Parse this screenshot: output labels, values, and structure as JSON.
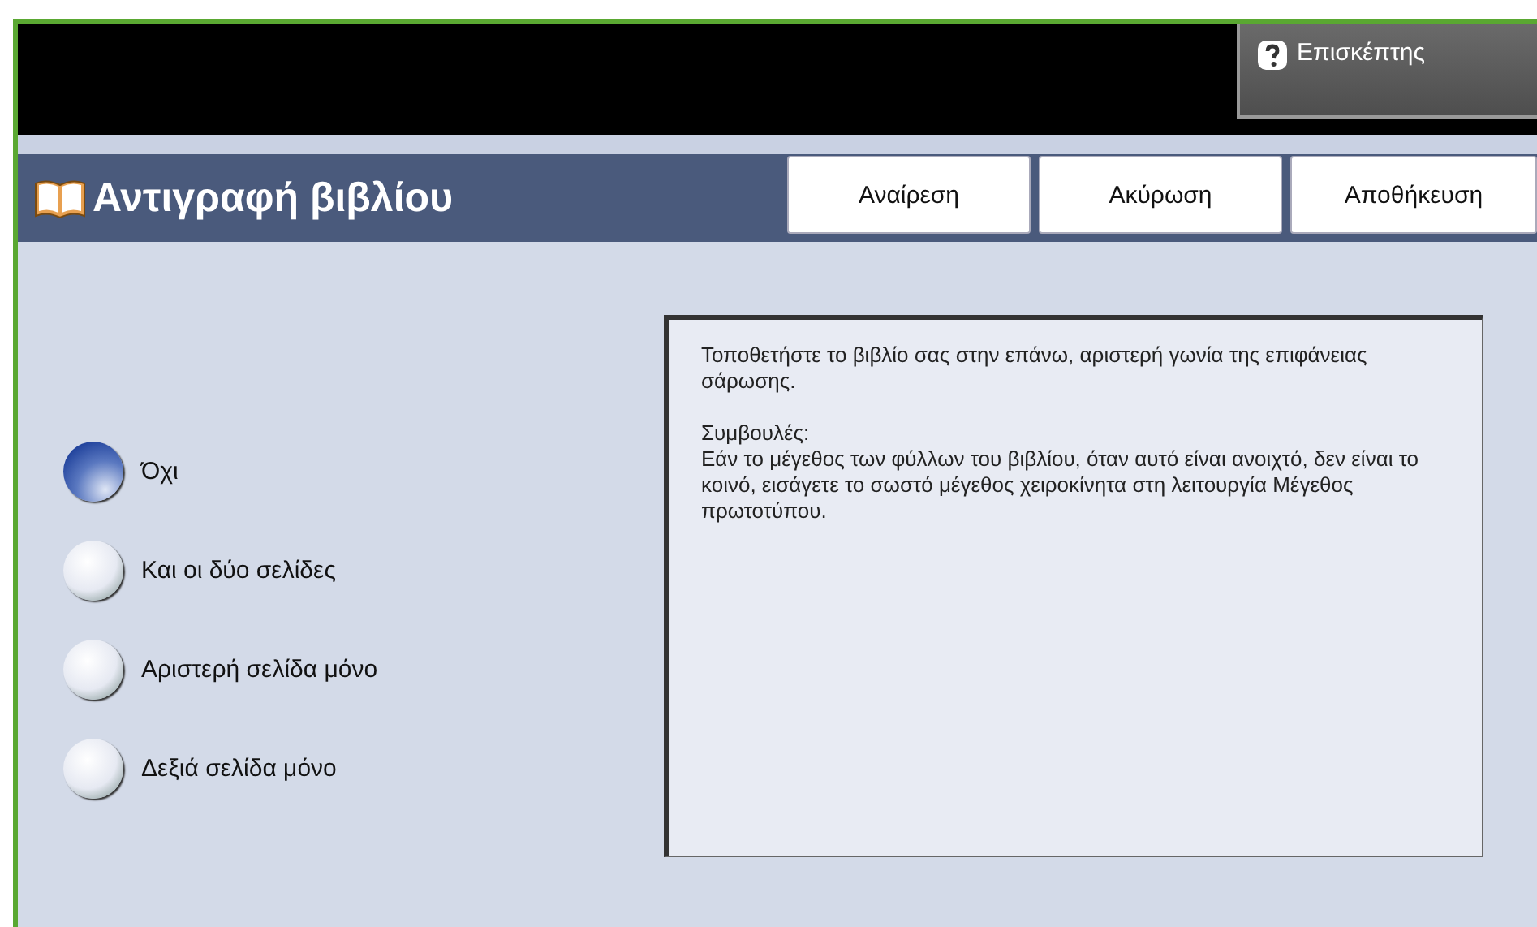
{
  "header": {
    "user_button": "Επισκέπτης"
  },
  "title_bar": {
    "title": "Αντιγραφή βιβλίου",
    "buttons": [
      "Αναίρεση",
      "Ακύρωση",
      "Αποθήκευση"
    ]
  },
  "options": [
    {
      "label": "Όχι",
      "selected": true
    },
    {
      "label": "Και οι δύο σελίδες",
      "selected": false
    },
    {
      "label": "Αριστερή σελίδα μόνο",
      "selected": false
    },
    {
      "label": "Δεξιά σελίδα μόνο",
      "selected": false
    }
  ],
  "info_panel": {
    "paragraphs": [
      "Τοποθετήστε το βιβλίο σας στην επάνω, αριστερή γωνία της επιφάνειας σάρωσης.",
      "Συμβουλές:\nΕάν το μέγεθος των φύλλων του βιβλίου, όταν αυτό είναι ανοιχτό, δεν είναι το κοινό, εισάγετε το σωστό μέγεθος χειροκίνητα στη λειτουργία Μέγεθος πρωτοτύπου."
    ]
  }
}
